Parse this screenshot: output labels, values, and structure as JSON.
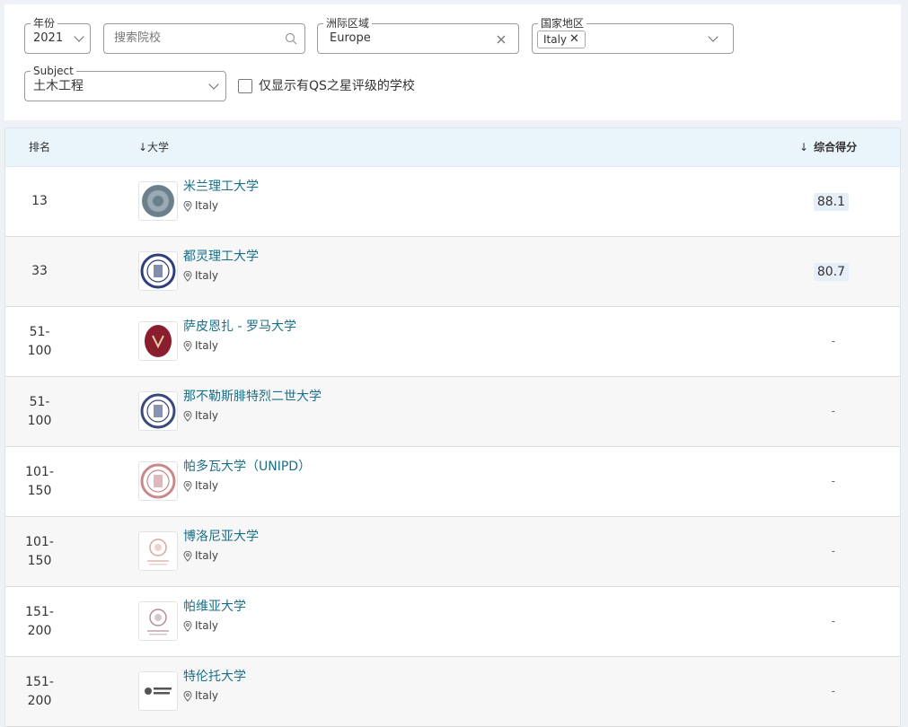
{
  "filters": {
    "year": {
      "legend": "年份",
      "value": "2021"
    },
    "search": {
      "placeholder": "搜索院校"
    },
    "region": {
      "legend": "洲际区域",
      "value": "Europe"
    },
    "country": {
      "legend": "国家地区",
      "chip": "Italy"
    },
    "subject": {
      "legend": "Subject",
      "value": "土木工程"
    },
    "qs_stars_only": {
      "label": "仅显示有QS之星评级的学校",
      "checked": false
    }
  },
  "table": {
    "headers": {
      "rank": "排名",
      "university": "↓大学",
      "overall": "综合得分"
    },
    "rows": [
      {
        "rank": "13",
        "name": "米兰理工大学",
        "country": "Italy",
        "score": "88.1"
      },
      {
        "rank": "33",
        "name": "都灵理工大学",
        "country": "Italy",
        "score": "80.7"
      },
      {
        "rank": "51-\n100",
        "name": "萨皮恩扎 - 罗马大学",
        "country": "Italy",
        "score": "-"
      },
      {
        "rank": "51-\n100",
        "name": "那不勒斯腓特烈二世大学",
        "country": "Italy",
        "score": "-"
      },
      {
        "rank": "101-\n150",
        "name": "帕多瓦大学（UNIPD）",
        "country": "Italy",
        "score": "-"
      },
      {
        "rank": "101-\n150",
        "name": "博洛尼亚大学",
        "country": "Italy",
        "score": "-"
      },
      {
        "rank": "151-\n200",
        "name": "帕维亚大学",
        "country": "Italy",
        "score": "-"
      },
      {
        "rank": "151-\n200",
        "name": "特伦托大学",
        "country": "Italy",
        "score": "-"
      }
    ]
  },
  "colors": {
    "link": "#1a6f86",
    "header_bg": "#eaf4fb",
    "score_bg": "#e6eef7",
    "logo_tints": [
      "#6b7f8c",
      "#2e3f7a",
      "#8b1e2d",
      "#3a4a7c",
      "#c9898a",
      "#d9a59b",
      "#b58a97",
      "#555555"
    ]
  },
  "icons": {
    "search": "search-icon",
    "clear": "close-icon",
    "chevron": "chevron-down-icon",
    "location": "map-pin-icon",
    "sort": "arrow-down-icon"
  }
}
